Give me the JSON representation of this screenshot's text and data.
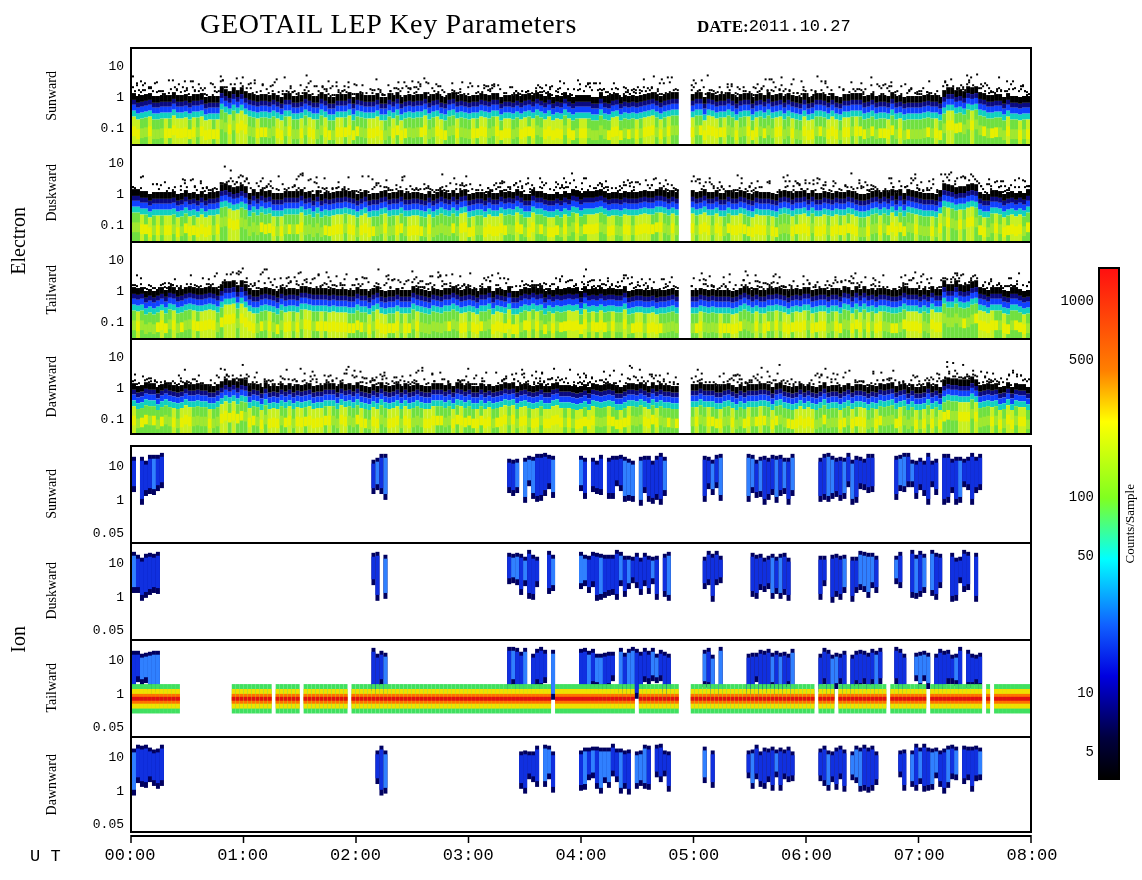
{
  "title": "GEOTAIL LEP Key Parameters",
  "date": {
    "label": "DATE:",
    "value": "2011.10.27"
  },
  "groups": [
    {
      "name": "Electron",
      "kind": "electron",
      "panels": [
        {
          "label": "Sunward",
          "yticks": [
            "10",
            "1",
            "0.1"
          ]
        },
        {
          "label": "Duskward",
          "yticks": [
            "10",
            "1",
            "0.1"
          ]
        },
        {
          "label": "Tailward",
          "yticks": [
            "10",
            "1",
            "0.1"
          ]
        },
        {
          "label": "Dawnward",
          "yticks": [
            "10",
            "1",
            "0.1"
          ]
        }
      ]
    },
    {
      "name": "Ion",
      "kind": "ion",
      "panels": [
        {
          "label": "Sunward",
          "yticks": [
            "10",
            "1",
            "0.05"
          ]
        },
        {
          "label": "Duskward",
          "yticks": [
            "10",
            "1",
            "0.05"
          ]
        },
        {
          "label": "Tailward",
          "yticks": [
            "10",
            "1",
            "0.05"
          ]
        },
        {
          "label": "Dawnward",
          "yticks": [
            "10",
            "1",
            "0.05"
          ]
        }
      ]
    }
  ],
  "x_axis": {
    "label": "U T",
    "ticks": [
      "00:00",
      "01:00",
      "02:00",
      "03:00",
      "04:00",
      "05:00",
      "06:00",
      "07:00",
      "08:00"
    ]
  },
  "colorbar": {
    "label": "Counts/Sample",
    "ticks": [
      "1000",
      "500",
      "100",
      "50",
      "10",
      "5"
    ]
  }
}
